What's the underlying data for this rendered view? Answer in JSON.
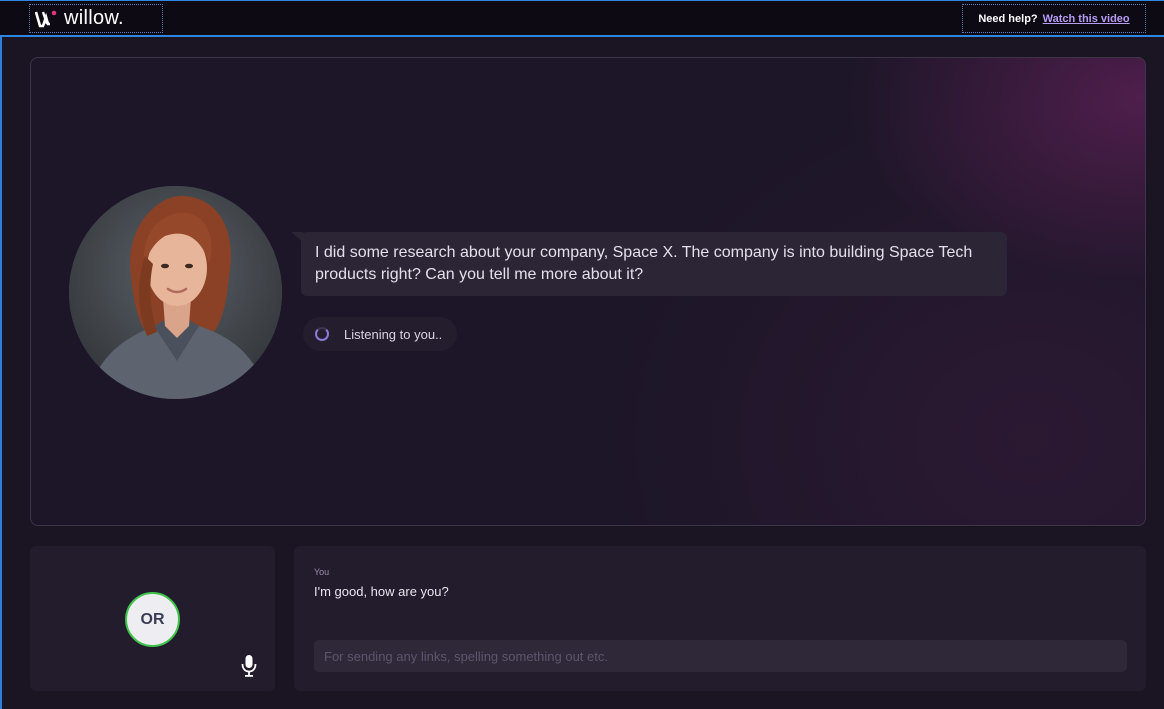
{
  "header": {
    "logo_text": "willow.",
    "help_label": "Need help?",
    "help_link": "Watch this video"
  },
  "conversation": {
    "ai_message": "I did some research about your company, Space X. The company is into building Space Tech products right? Can you tell me more about it?",
    "status": "Listening to you.."
  },
  "user_panel": {
    "initials": "OR"
  },
  "transcript": {
    "speaker": "You",
    "text": "I'm good, how are you?",
    "input_placeholder": "For sending any links, spelling something out etc."
  },
  "colors": {
    "accent_link": "#b79cf5",
    "badge_border": "#3ec34b",
    "focus_border": "#2f86e0"
  },
  "icons": [
    "willow-logo-icon",
    "spinner-icon",
    "microphone-icon"
  ]
}
